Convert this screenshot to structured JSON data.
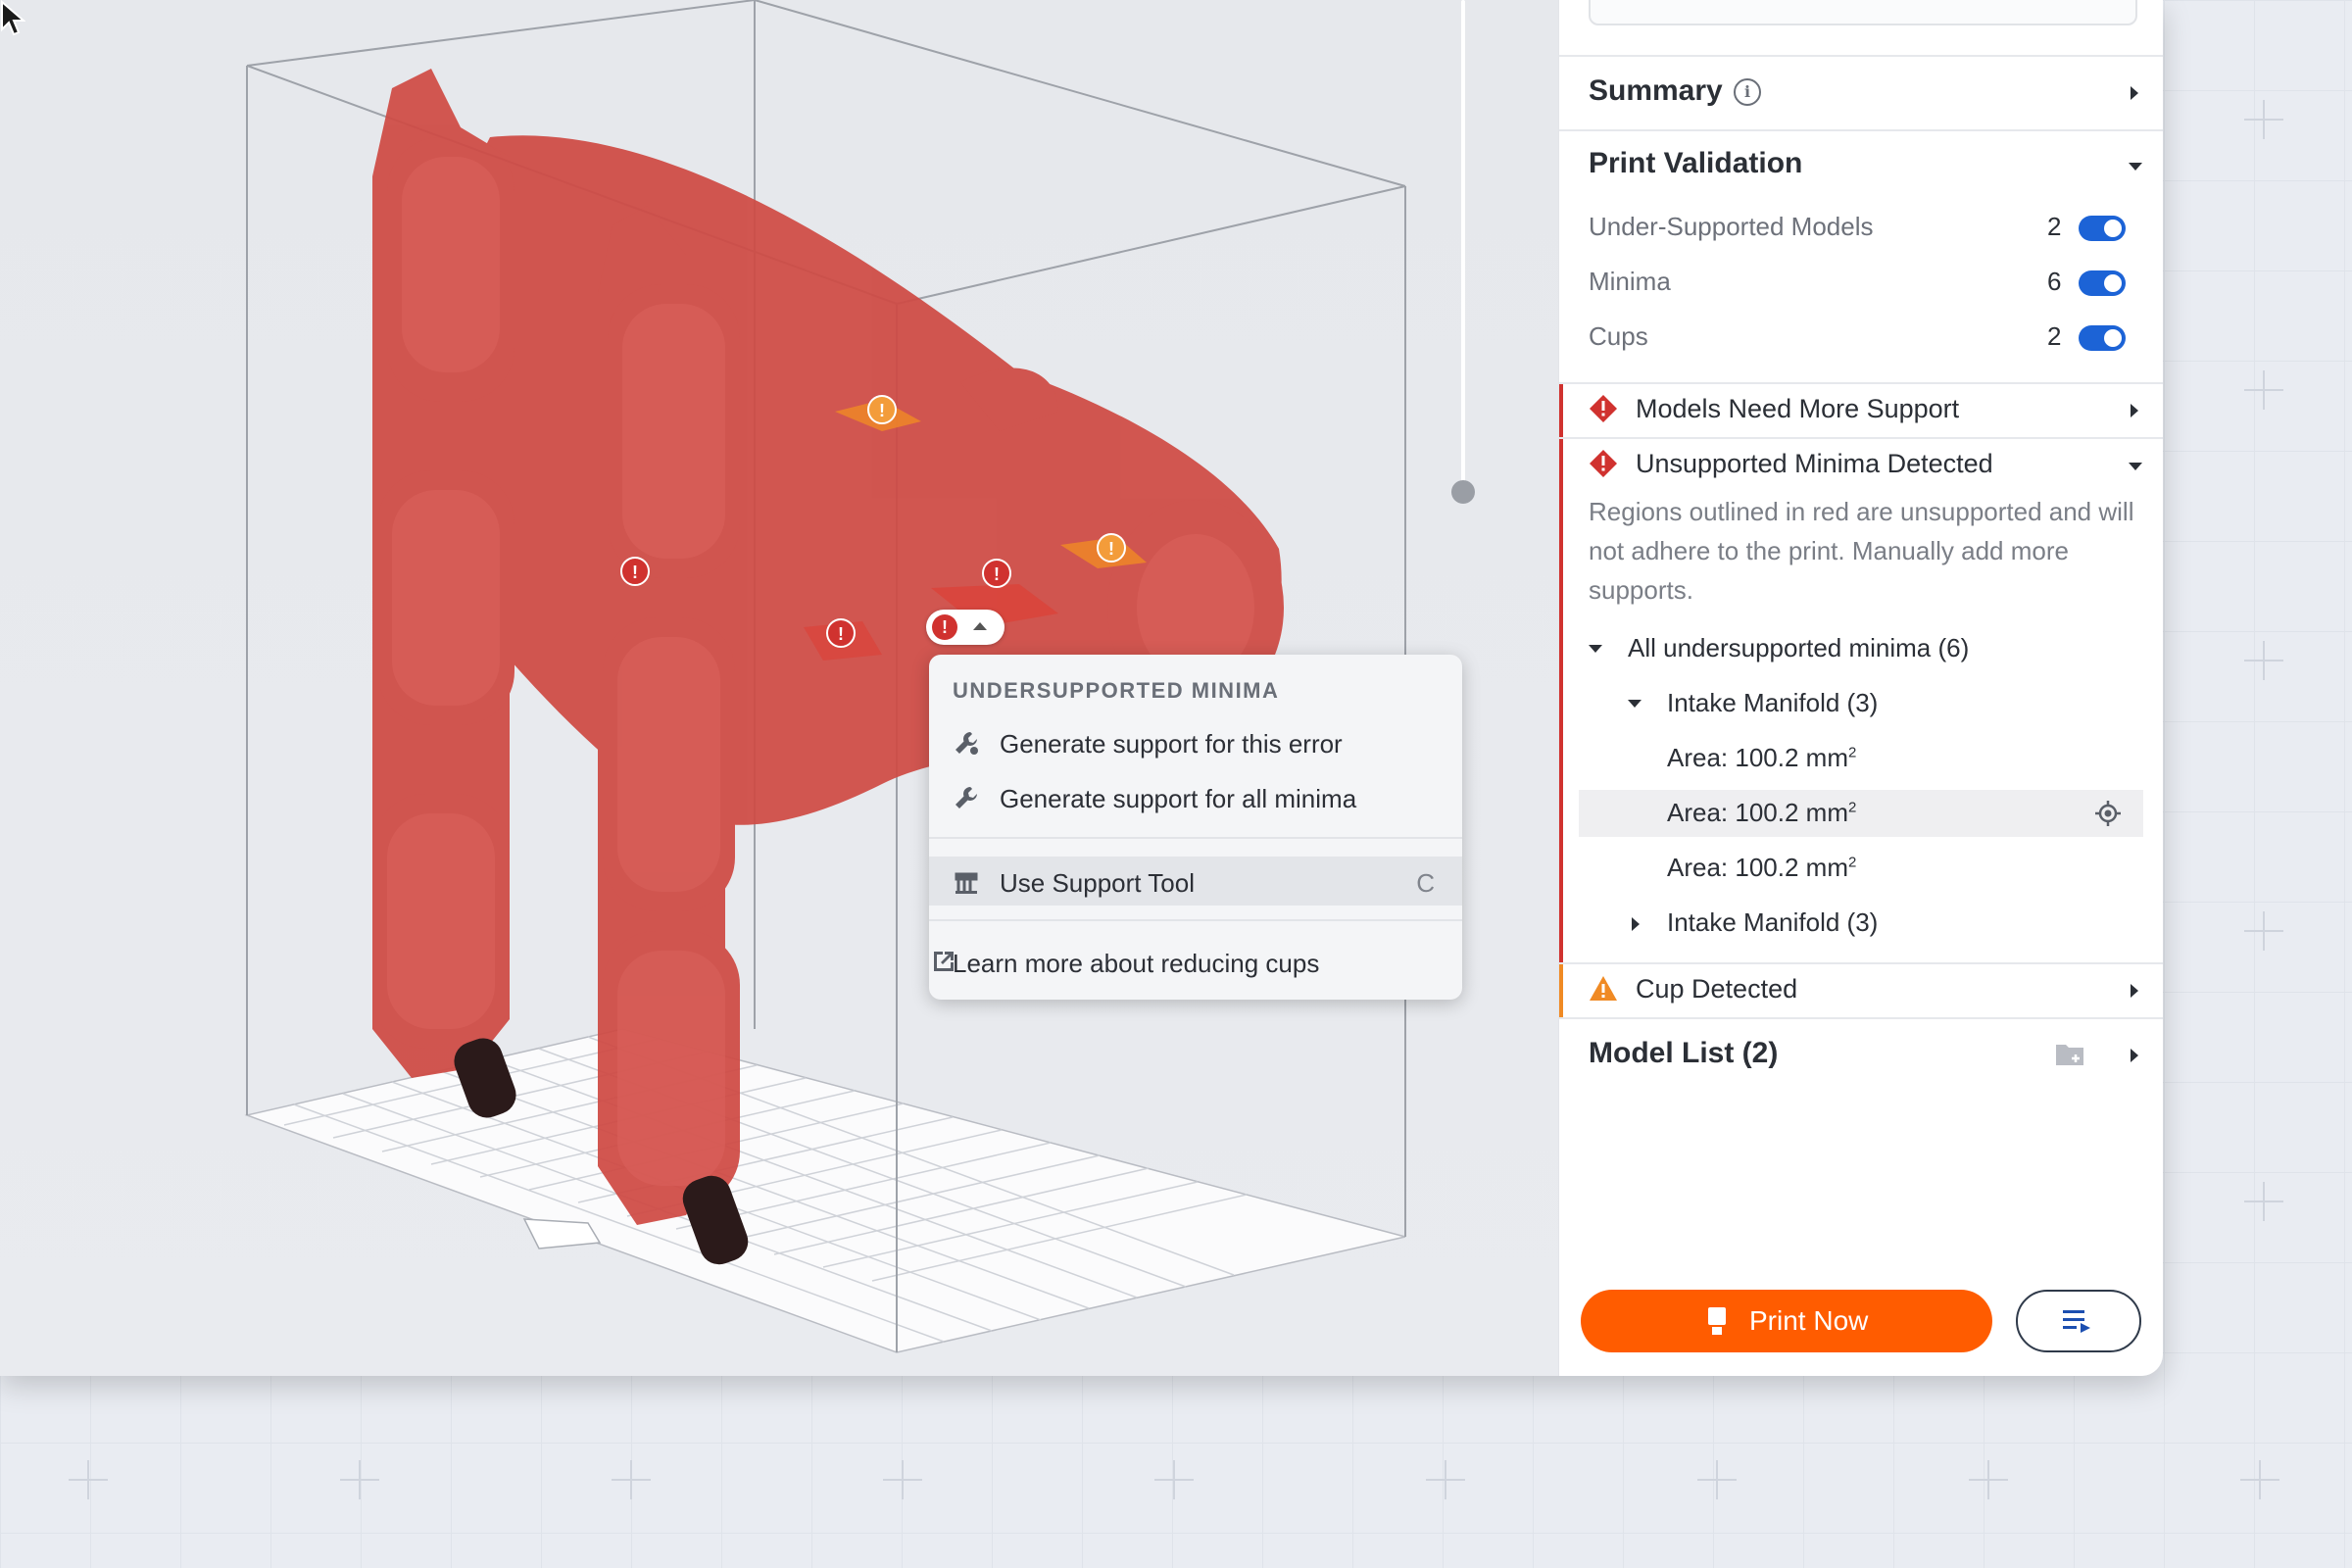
{
  "context_menu": {
    "title": "UNDERSUPPORTED MINIMA",
    "items": [
      {
        "label": "Generate support for this error",
        "icon": "wrench-icon"
      },
      {
        "label": "Generate support for all minima",
        "icon": "wrench-icon"
      },
      {
        "label": "Use Support Tool",
        "icon": "support-tool-icon",
        "shortcut": "C"
      },
      {
        "label": "Learn more about reducing cups",
        "icon": "external-link-icon"
      }
    ]
  },
  "sidebar": {
    "summary": {
      "title": "Summary"
    },
    "print_validation": {
      "title": "Print Validation",
      "rows": [
        {
          "label": "Under-Supported Models",
          "count": "2",
          "enabled": true
        },
        {
          "label": "Minima",
          "count": "6",
          "enabled": true
        },
        {
          "label": "Cups",
          "count": "2",
          "enabled": true
        }
      ]
    },
    "alerts": {
      "models_need_support": {
        "title": "Models Need More Support",
        "severity": "error"
      },
      "unsupported_minima": {
        "title": "Unsupported Minima Detected",
        "severity": "error",
        "description": "Regions outlined in red are unsupported and will not adhere to the print. Manually add more supports.",
        "tree": {
          "root": "All undersupported minima (6)",
          "group1": "Intake Manifold (3)",
          "areas": [
            "Area: 100.2 mm",
            "Area: 100.2 mm",
            "Area: 100.2 mm"
          ],
          "area_exponent": "2",
          "group2": "Intake Manifold (3)"
        }
      },
      "cup_detected": {
        "title": "Cup Detected",
        "severity": "warning"
      }
    },
    "model_list": {
      "title": "Model List (2)"
    },
    "buttons": {
      "print_now": "Print Now"
    }
  },
  "colors": {
    "error": "#d0322f",
    "warning": "#f08a24",
    "accent": "#ff5c00",
    "toggle": "#1c63d6",
    "model": "#cf4a44"
  }
}
